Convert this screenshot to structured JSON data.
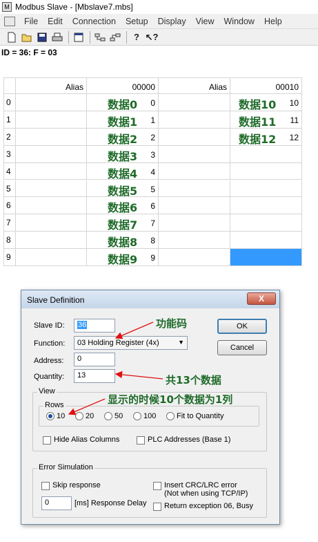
{
  "window": {
    "title": "Modbus Slave - [Mbslave7.mbs]"
  },
  "menu": [
    "File",
    "Edit",
    "Connection",
    "Setup",
    "Display",
    "View",
    "Window",
    "Help"
  ],
  "toolbar": {
    "buttons": [
      "new-icon",
      "open-icon",
      "save-icon",
      "print-icon",
      "window-icon",
      "slave-definition-icon",
      "connection-icon",
      "help-icon",
      "context-help-icon"
    ]
  },
  "status": {
    "text": "ID = 36: F = 03"
  },
  "grid": {
    "headers": {
      "alias1": "Alias",
      "addr1": "00000",
      "alias2": "Alias",
      "addr2": "00010"
    },
    "rows": [
      {
        "num": "0",
        "annot1": "数据0",
        "val1": "0",
        "annot2": "数据10",
        "val2": "10"
      },
      {
        "num": "1",
        "annot1": "数据1",
        "val1": "1",
        "annot2": "数据11",
        "val2": "11"
      },
      {
        "num": "2",
        "annot1": "数据2",
        "val1": "2",
        "annot2": "数据12",
        "val2": "12"
      },
      {
        "num": "3",
        "annot1": "数据3",
        "val1": "3"
      },
      {
        "num": "4",
        "annot1": "数据4",
        "val1": "4"
      },
      {
        "num": "5",
        "annot1": "数据5",
        "val1": "5"
      },
      {
        "num": "6",
        "annot1": "数据6",
        "val1": "6"
      },
      {
        "num": "7",
        "annot1": "数据7",
        "val1": "7"
      },
      {
        "num": "8",
        "annot1": "数据8",
        "val1": "8"
      },
      {
        "num": "9",
        "annot1": "数据9",
        "val1": "9"
      }
    ],
    "selected_cell_color": "#3399ff"
  },
  "dialog": {
    "title": "Slave Definition",
    "close_label": "X",
    "slave_id_label": "Slave ID:",
    "slave_id_value": "36",
    "function_label": "Function:",
    "function_value": "03 Holding Register (4x)",
    "address_label": "Address:",
    "address_value": "0",
    "quantity_label": "Quantity:",
    "quantity_value": "13",
    "ok_label": "OK",
    "cancel_label": "Cancel",
    "view_group": "View",
    "rows_group": "Rows",
    "rows_options": [
      "10",
      "20",
      "50",
      "100",
      "Fit to Quantity"
    ],
    "rows_selected": "10",
    "hide_alias_label": "Hide Alias Columns",
    "plc_addresses_label": "PLC Addresses (Base 1)",
    "error_group": "Error Simulation",
    "skip_response_label": "Skip response",
    "insert_crc_label": "Insert CRC/LRC error",
    "insert_crc_note": "(Not when using TCP/IP)",
    "delay_value": "0",
    "delay_label": "[ms] Response Delay",
    "return_exception_label": "Return exception 06, Busy"
  },
  "annotations": {
    "function_code": "功能码",
    "total_count": "共13个数据",
    "display_note": "显示的时候10个数据为1列",
    "color": "#1f6b2a",
    "arrow_color": "#e01010"
  }
}
